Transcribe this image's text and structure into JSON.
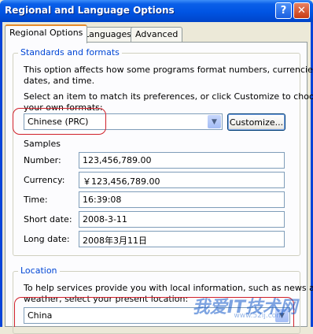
{
  "window": {
    "title": "Regional and Language Options",
    "help_glyph": "?",
    "close_glyph": "✕"
  },
  "tabs": [
    {
      "label": "Regional Options",
      "active": true
    },
    {
      "label": "Languages",
      "active": false
    },
    {
      "label": "Advanced",
      "active": false
    }
  ],
  "standards": {
    "legend": "Standards and formats",
    "description_line1": "This option affects how some programs format numbers, currencies,",
    "description_line2": "dates, and time.",
    "select_prompt_line1": "Select an item to match its preferences, or click Customize to choose",
    "select_prompt_line2": "your own formats:",
    "selected_format": "Chinese (PRC)",
    "customize_label": "Customize..."
  },
  "samples": {
    "heading": "Samples",
    "rows": [
      {
        "label": "Number:",
        "value": "123,456,789.00"
      },
      {
        "label": "Currency:",
        "value": "￥123,456,789.00"
      },
      {
        "label": "Time:",
        "value": "16:39:08"
      },
      {
        "label": "Short date:",
        "value": "2008-3-11"
      },
      {
        "label": "Long date:",
        "value": "2008年3月11日"
      }
    ]
  },
  "location": {
    "legend": "Location",
    "help_line1": "To help services provide you with local information, such as news and",
    "help_line2": "weather, select your present location:",
    "selected_location": "China"
  },
  "watermark": {
    "text": "我爱IT技术网",
    "url": "www.52ij.com"
  },
  "colors": {
    "titlebar": "#0054e3",
    "legend": "#0046d5",
    "highlight": "#d0202a",
    "active_tab_accent": "#e68b2c"
  }
}
